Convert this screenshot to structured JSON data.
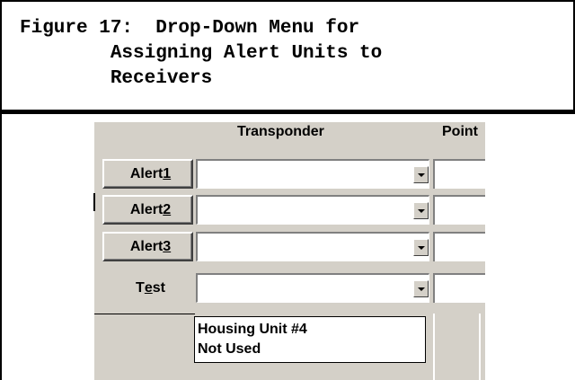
{
  "caption": "Figure 17:  Drop-Down Menu for\n        Assigning Alert Units to\n        Receivers",
  "columns": {
    "transponder": "Transponder",
    "point": "Point"
  },
  "rows": [
    {
      "label": "Alert ",
      "hotkey": "1",
      "value": "",
      "point": ""
    },
    {
      "label": "Alert ",
      "hotkey": "2",
      "value": "",
      "point": ""
    },
    {
      "label": "Alert ",
      "hotkey": "3",
      "value": "",
      "point": ""
    }
  ],
  "test": {
    "pre": "T",
    "hotkey": "e",
    "post": "st",
    "value": "",
    "point": ""
  },
  "dropdown_options": [
    "Housing Unit #4",
    "Not Used"
  ]
}
